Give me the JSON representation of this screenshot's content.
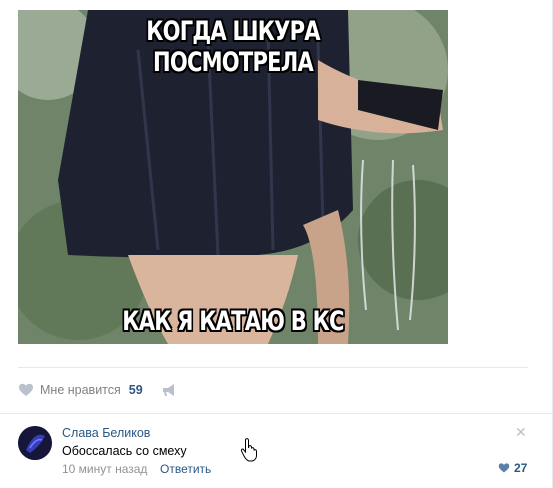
{
  "post": {
    "meme_top_caption": "КОГДА ШКУРА ПОСМОТРЕЛА",
    "meme_bottom_caption": "КАК Я КАТАЮ В КС",
    "like_label": "Мне нравится",
    "like_count": "59"
  },
  "comment": {
    "author": "Слава Беликов",
    "text": "Обоссалась со смеху",
    "time": "10 минут назад",
    "reply_label": "Ответить",
    "like_count": "27",
    "close_symbol": "✕"
  },
  "colors": {
    "link": "#2a5885",
    "muted": "#828282",
    "icon": "#b8c1cc",
    "divider": "#e7e8ec"
  }
}
